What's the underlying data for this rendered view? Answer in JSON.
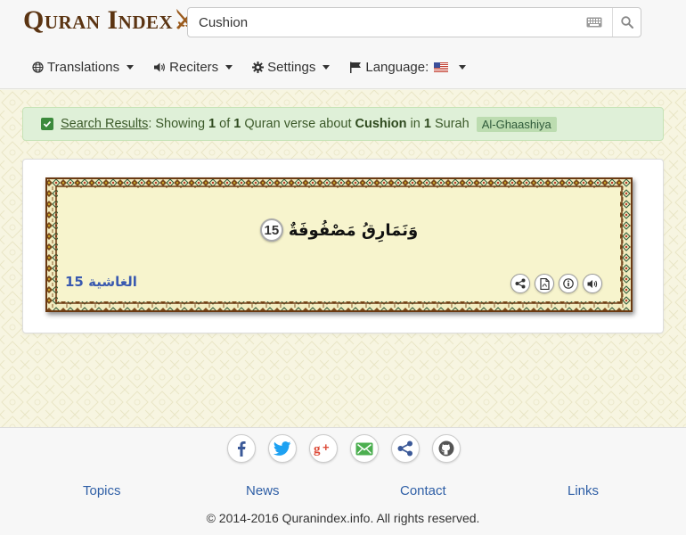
{
  "header": {
    "logo_text": "Quran Index",
    "search": {
      "value": "Cushion",
      "placeholder": ""
    }
  },
  "nav": {
    "translations": "Translations",
    "reciters": "Reciters",
    "settings": "Settings",
    "language": "Language:"
  },
  "alert": {
    "link": "Search Results",
    "showing": ": Showing ",
    "current": "1",
    "of": " of ",
    "total": "1",
    "verse_about": " Quran verse about ",
    "keyword": "Cushion",
    "in": " in ",
    "surah_count": "1",
    "surah_word": " Surah",
    "surah_badge": "Al-Ghaashiya"
  },
  "verse": {
    "number": "15",
    "arabic": "وَنَمَارِقُ مَصْفُوفَةٌ",
    "reference": "الغاشية 15"
  },
  "footer": {
    "links": [
      "Topics",
      "News",
      "Contact",
      "Links"
    ],
    "copyright": "© 2014-2016 Quranindex.info. All rights reserved."
  },
  "colors": {
    "logo": "#5b3412",
    "alert_bg": "#dff0d8",
    "verse_bg": "#f7f4cd",
    "link": "#2f5fa6",
    "verse_ref": "#3a5ab0",
    "facebook": "#3b5998",
    "twitter": "#1da1f2",
    "google_plus": "#dd4b39",
    "email": "#4caf50",
    "share": "#3b5998",
    "github": "#555555"
  },
  "icons": {
    "social": [
      "facebook-icon",
      "twitter-icon",
      "google-plus-icon",
      "email-icon",
      "share-icon",
      "github-icon"
    ],
    "verse_actions": [
      "share-icon",
      "pdf-icon",
      "info-icon",
      "audio-icon"
    ]
  }
}
